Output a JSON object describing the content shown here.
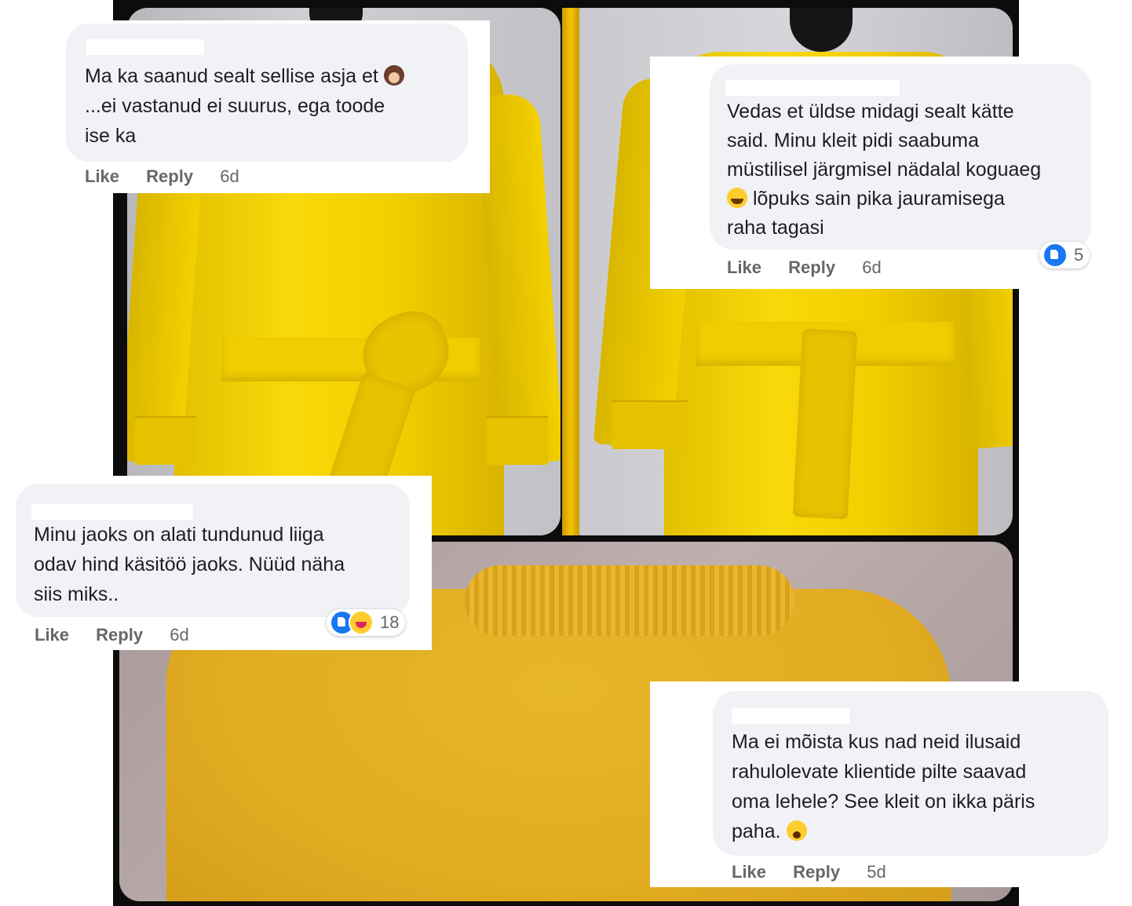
{
  "comments": [
    {
      "text_line1": "Ma ka saanud sealt sellise asja et",
      "text_line2": "...ei vastanud ei suurus, ega toode",
      "text_line3": "ise ka",
      "like_label": "Like",
      "reply_label": "Reply",
      "time": "6d"
    },
    {
      "text_line1": "Vedas et üldse midagi sealt kätte",
      "text_line2": "said. Minu kleit pidi saabuma",
      "text_line3": "müstilisel järgmisel nädalal koguaeg",
      "text_line4": "lõpuks sain pika jauramisega",
      "text_line5": "raha tagasi",
      "like_label": "Like",
      "reply_label": "Reply",
      "time": "6d",
      "reaction_count": "5"
    },
    {
      "text_line1": "Minu jaoks on alati tundunud liiga",
      "text_line2": "odav hind käsitöö jaoks. Nüüd näha",
      "text_line3": "siis miks..",
      "like_label": "Like",
      "reply_label": "Reply",
      "time": "6d",
      "reaction_count": "18"
    },
    {
      "text_line1": "Ma ei mõista kus nad neid ilusaid",
      "text_line2": "rahulolevate klientide pilte saavad",
      "text_line3": "oma lehele? See kleit on ikka päris",
      "text_line4": "paha.",
      "like_label": "Like",
      "reply_label": "Reply",
      "time": "5d"
    }
  ],
  "icons": {
    "comment1_emoji": "woman-facepalming-emoji",
    "comment2_emoji": "grinning-face-emoji",
    "comment4_emoji": "crying-face-emoji",
    "reactions_comment2": [
      "like"
    ],
    "reactions_comment3": [
      "like",
      "haha"
    ]
  },
  "colors": {
    "bubble": "#f0f2f5",
    "like_blue": "#1877f2",
    "dress_yellow": "#f3cf00",
    "action_gray": "#65676b"
  }
}
